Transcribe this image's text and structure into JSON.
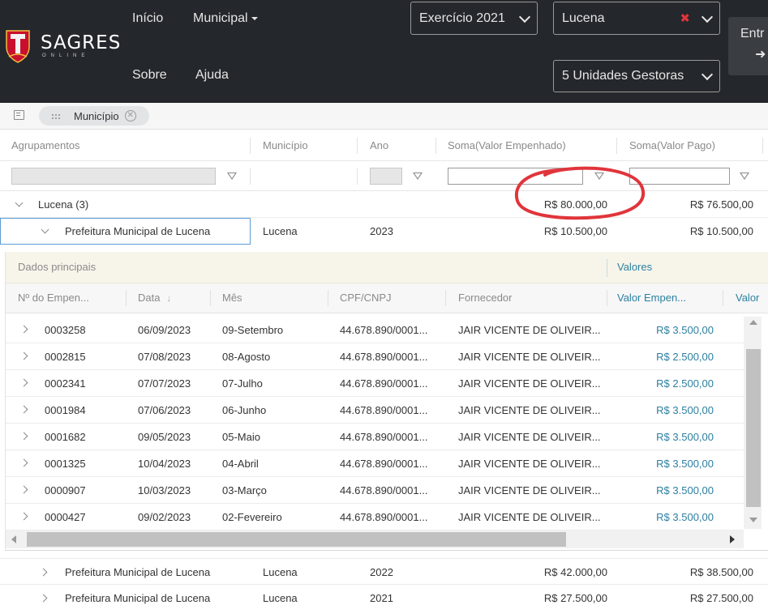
{
  "navbar": {
    "brand": "SAGRES",
    "brand_sub": "ONLINE",
    "links": [
      "Início",
      "Municipal",
      "Sobre",
      "Ajuda"
    ],
    "exercicio": "Exercício 2021",
    "municipio": "Lucena",
    "clear_symbol": "✖",
    "unidades": "5 Unidades Gestoras",
    "entrar": "Entr",
    "entrar_icon": "➜"
  },
  "group_panel": {
    "chip_label": "Município",
    "chip_close": "✕"
  },
  "grid": {
    "headers": [
      "Agrupamentos",
      "Município",
      "Ano",
      "Soma(Valor Empenhado)",
      "Soma(Valor Pago)"
    ],
    "group_row": {
      "label": "Lucena (3)",
      "empenhado": "R$ 80.000,00",
      "pago": "R$ 76.500,00"
    },
    "rows": [
      {
        "unidade": "Prefeitura Municipal de Lucena",
        "municipio": "Lucena",
        "ano": "2023",
        "empenhado": "R$ 10.500,00",
        "pago": "R$ 10.500,00"
      },
      {
        "unidade": "Prefeitura Municipal de Lucena",
        "municipio": "Lucena",
        "ano": "2022",
        "empenhado": "R$ 42.000,00",
        "pago": "R$ 38.500,00"
      },
      {
        "unidade": "Prefeitura Municipal de Lucena",
        "municipio": "Lucena",
        "ano": "2021",
        "empenhado": "R$ 27.500,00",
        "pago": "R$ 27.500,00"
      }
    ]
  },
  "detail": {
    "band_title": "Dados principais",
    "band_valores": "Valores",
    "headers": [
      "Nº do Empen...",
      "Data",
      "Mês",
      "CPF/CNPJ",
      "Fornecedor",
      "Valor Empen...",
      "Valor"
    ],
    "sort_symbol": "↓",
    "rows": [
      {
        "num": "0003258",
        "data": "06/09/2023",
        "mes": "09-Setembro",
        "cpf": "44.678.890/0001...",
        "fornecedor": "JAIR VICENTE DE OLIVEIR...",
        "valor": "R$ 3.500,00"
      },
      {
        "num": "0002815",
        "data": "07/08/2023",
        "mes": "08-Agosto",
        "cpf": "44.678.890/0001...",
        "fornecedor": "JAIR VICENTE DE OLIVEIR...",
        "valor": "R$ 2.500,00"
      },
      {
        "num": "0002341",
        "data": "07/07/2023",
        "mes": "07-Julho",
        "cpf": "44.678.890/0001...",
        "fornecedor": "JAIR VICENTE DE OLIVEIR...",
        "valor": "R$ 2.500,00"
      },
      {
        "num": "0001984",
        "data": "07/06/2023",
        "mes": "06-Junho",
        "cpf": "44.678.890/0001...",
        "fornecedor": "JAIR VICENTE DE OLIVEIR...",
        "valor": "R$ 3.500,00"
      },
      {
        "num": "0001682",
        "data": "09/05/2023",
        "mes": "05-Maio",
        "cpf": "44.678.890/0001...",
        "fornecedor": "JAIR VICENTE DE OLIVEIR...",
        "valor": "R$ 3.500,00"
      },
      {
        "num": "0001325",
        "data": "10/04/2023",
        "mes": "04-Abril",
        "cpf": "44.678.890/0001...",
        "fornecedor": "JAIR VICENTE DE OLIVEIR...",
        "valor": "R$ 3.500,00"
      },
      {
        "num": "0000907",
        "data": "10/03/2023",
        "mes": "03-Março",
        "cpf": "44.678.890/0001...",
        "fornecedor": "JAIR VICENTE DE OLIVEIR...",
        "valor": "R$ 3.500,00"
      },
      {
        "num": "0000427",
        "data": "09/02/2023",
        "mes": "02-Fevereiro",
        "cpf": "44.678.890/0001...",
        "fornecedor": "JAIR VICENTE DE OLIVEIR...",
        "valor": "R$ 3.500,00"
      }
    ]
  },
  "colors": {
    "navbar_bg": "#24272b",
    "accent_teal": "#2c7fa0",
    "annotation_red": "#e0353b",
    "band_bg": "#f7f5ea"
  }
}
